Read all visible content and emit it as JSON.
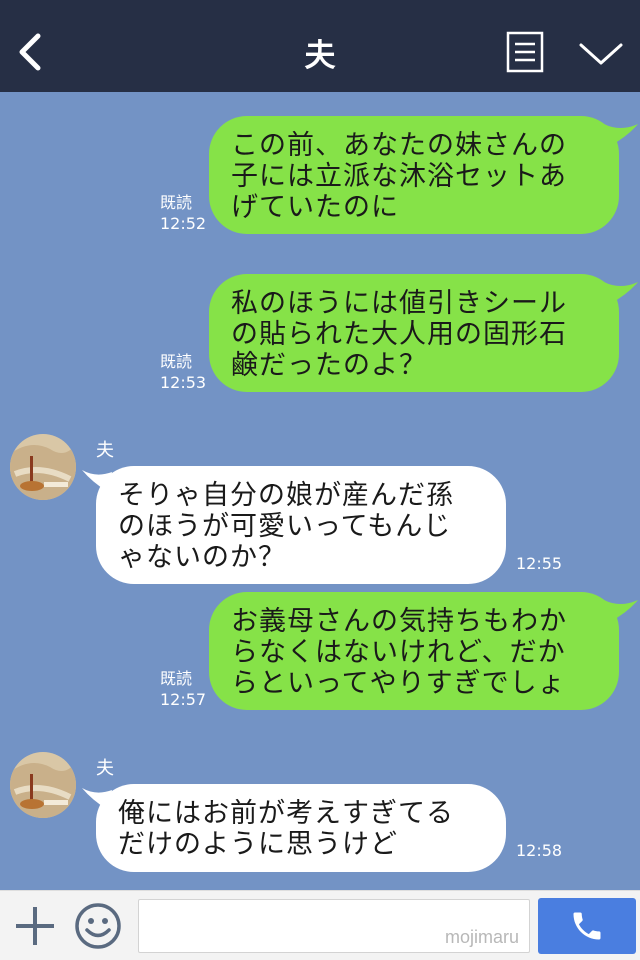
{
  "header": {
    "title": "夫",
    "icons": {
      "back": "chevron-left-icon",
      "notes": "notes-icon",
      "menu": "chevron-down-icon"
    }
  },
  "messages": [
    {
      "from": "me",
      "lines": [
        "この前、あなたの妹さんの",
        "子には立派な沐浴セットあ",
        "げていたのに"
      ],
      "read": "既読",
      "time": "12:52"
    },
    {
      "from": "me",
      "lines": [
        "私のほうには値引きシール",
        "の貼られた大人用の固形石",
        "鹸だったのよ？"
      ],
      "read": "既読",
      "time": "12:53"
    },
    {
      "from": "them",
      "sender": "夫",
      "lines": [
        "そりゃ自分の娘が産んだ孫",
        "のほうが可愛いってもんじ",
        "ゃないのか？"
      ],
      "time": "12:55"
    },
    {
      "from": "me",
      "lines": [
        "お義母さんの気持ちもわか",
        "らなくはないけれど、だか",
        "らといってやりすぎでしょ"
      ],
      "read": "既読",
      "time": "12:57"
    },
    {
      "from": "them",
      "sender": "夫",
      "lines": [
        "俺にはお前が考えすぎてる",
        "だけのように思うけど"
      ],
      "time": "12:58"
    }
  ],
  "footer": {
    "input_value": "",
    "watermark": "mojimaru",
    "icons": {
      "plus": "plus-icon",
      "emoji": "smile-icon",
      "call": "phone-icon"
    }
  },
  "colors": {
    "header_bg": "#262f45",
    "chat_bg": "#7393c5",
    "my_bubble": "#86e248",
    "their_bubble": "#ffffff",
    "call_button": "#4a7ee0"
  }
}
